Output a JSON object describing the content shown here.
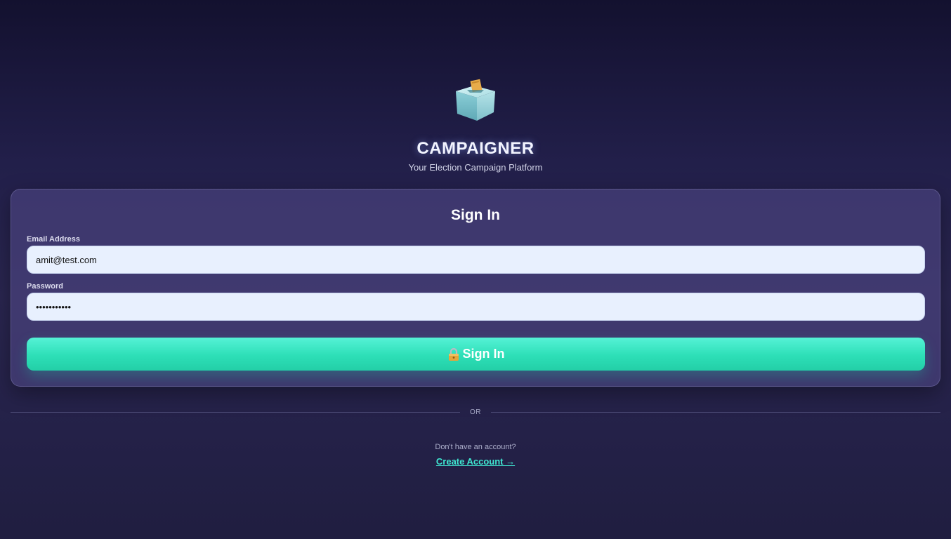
{
  "app": {
    "title": "CAMPAIGNER",
    "subtitle": "Your Election Campaign Platform",
    "logo_icon": "ballot-box-icon"
  },
  "form": {
    "heading": "Sign In",
    "email": {
      "label": "Email Address",
      "value": "amit@test.com"
    },
    "password": {
      "label": "Password",
      "value": "•••••••••••"
    },
    "submit_label": "Sign In",
    "submit_icon": "lock-icon"
  },
  "divider": {
    "text": "OR"
  },
  "signup": {
    "prompt": "Don't have an account?",
    "link_label": "Create Account →"
  },
  "colors": {
    "accent": "#2ddfb7",
    "link": "#3fe6d0",
    "input_bg": "#e8f0fe"
  }
}
